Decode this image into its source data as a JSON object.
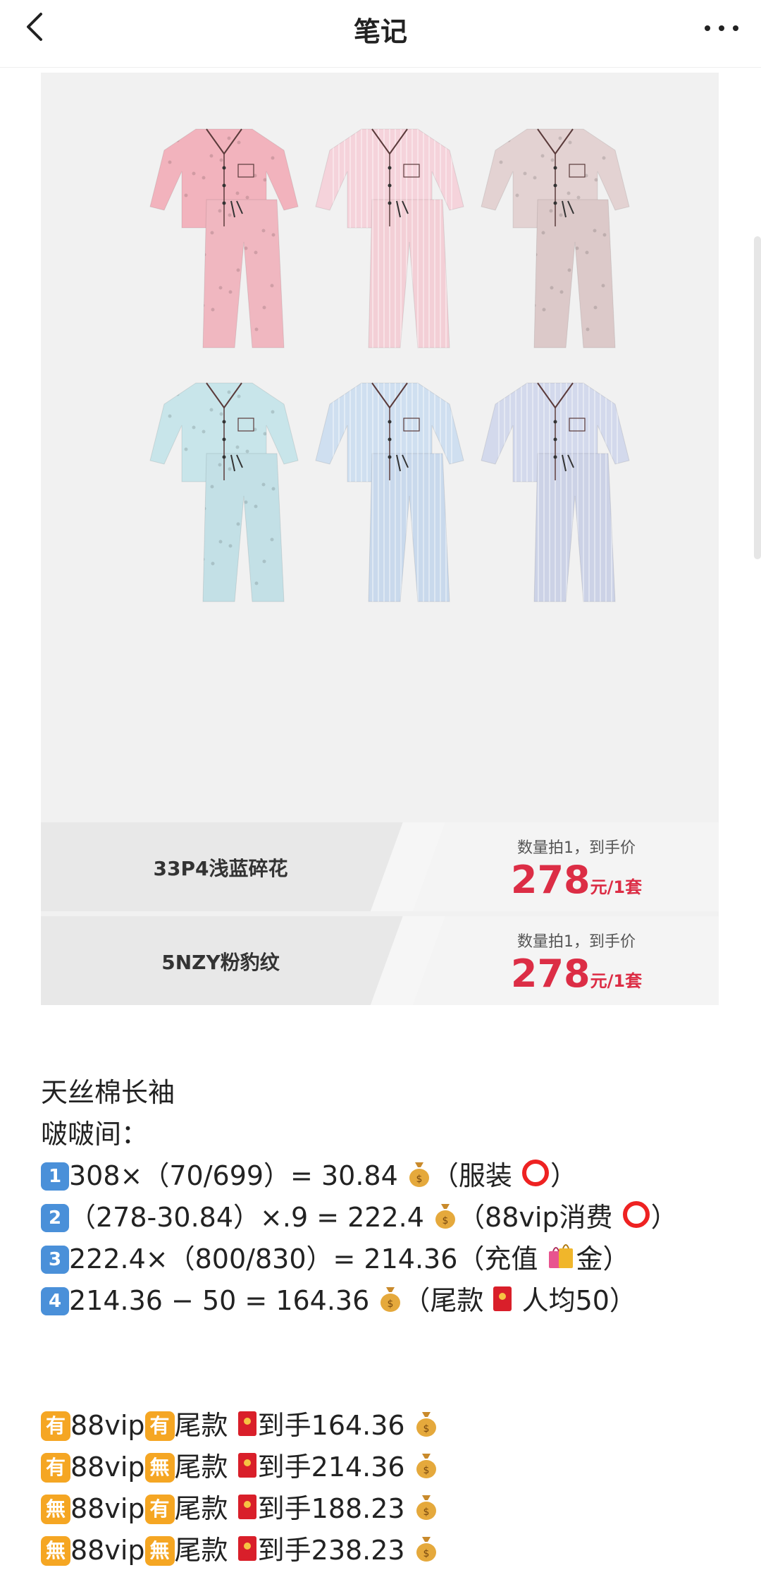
{
  "header": {
    "title": "笔记"
  },
  "products": [
    {
      "name": "33P4浅蓝碎花",
      "qty_note": "数量拍1，到手价",
      "price": "278",
      "unit": "元/1套"
    },
    {
      "name": "5NZY粉豹纹",
      "qty_note": "数量拍1，到手价",
      "price": "278",
      "unit": "元/1套"
    }
  ],
  "note": {
    "title": "天丝棉长袖",
    "subtitle": "啵啵间：",
    "steps": [
      {
        "num": "1",
        "before": "308×（70/699）= 30.84",
        "after": "（服装",
        "end": "）"
      },
      {
        "num": "2",
        "before": "（278-30.84）×.9 = 222.4",
        "after": "（88vip消费",
        "end": "）"
      },
      {
        "num": "3",
        "before": "222.4×（800/830）= 214.36（充值",
        "after": "金）",
        "end": ""
      },
      {
        "num": "4",
        "before": "214.36 − 50 = 164.36",
        "after": "（尾款",
        "end": " 人均50）"
      }
    ],
    "combos": [
      {
        "a": "有",
        "b": "有",
        "vip": "88vip",
        "tail": "尾款",
        "result": "到手164.36"
      },
      {
        "a": "有",
        "b": "無",
        "vip": "88vip",
        "tail": "尾款",
        "result": "到手214.36"
      },
      {
        "a": "無",
        "b": "有",
        "vip": "88vip",
        "tail": "尾款",
        "result": "到手188.23"
      },
      {
        "a": "無",
        "b": "無",
        "vip": "88vip",
        "tail": "尾款",
        "result": "到手238.23"
      }
    ]
  },
  "colors": {
    "price_red": "#dc2d45",
    "tag_orange": "#f5a623",
    "keycap_blue": "#4a90d9",
    "card_gray": "#f1f1f1"
  },
  "garments": [
    {
      "shirt": "#f2b3bd",
      "pants": "#f0b7c0",
      "pattern": "floral"
    },
    {
      "shirt": "#f5d3db",
      "pants": "#f3cfd6",
      "pattern": "stripe"
    },
    {
      "shirt": "#e3d2d2",
      "pants": "#dcc9c9",
      "pattern": "print"
    },
    {
      "shirt": "#c8e5ea",
      "pants": "#c3e0e6",
      "pattern": "floral"
    },
    {
      "shirt": "#cfdff0",
      "pants": "#c9d9ec",
      "pattern": "stripe"
    },
    {
      "shirt": "#d3d9ec",
      "pants": "#ccd2e6",
      "pattern": "stripe"
    }
  ]
}
